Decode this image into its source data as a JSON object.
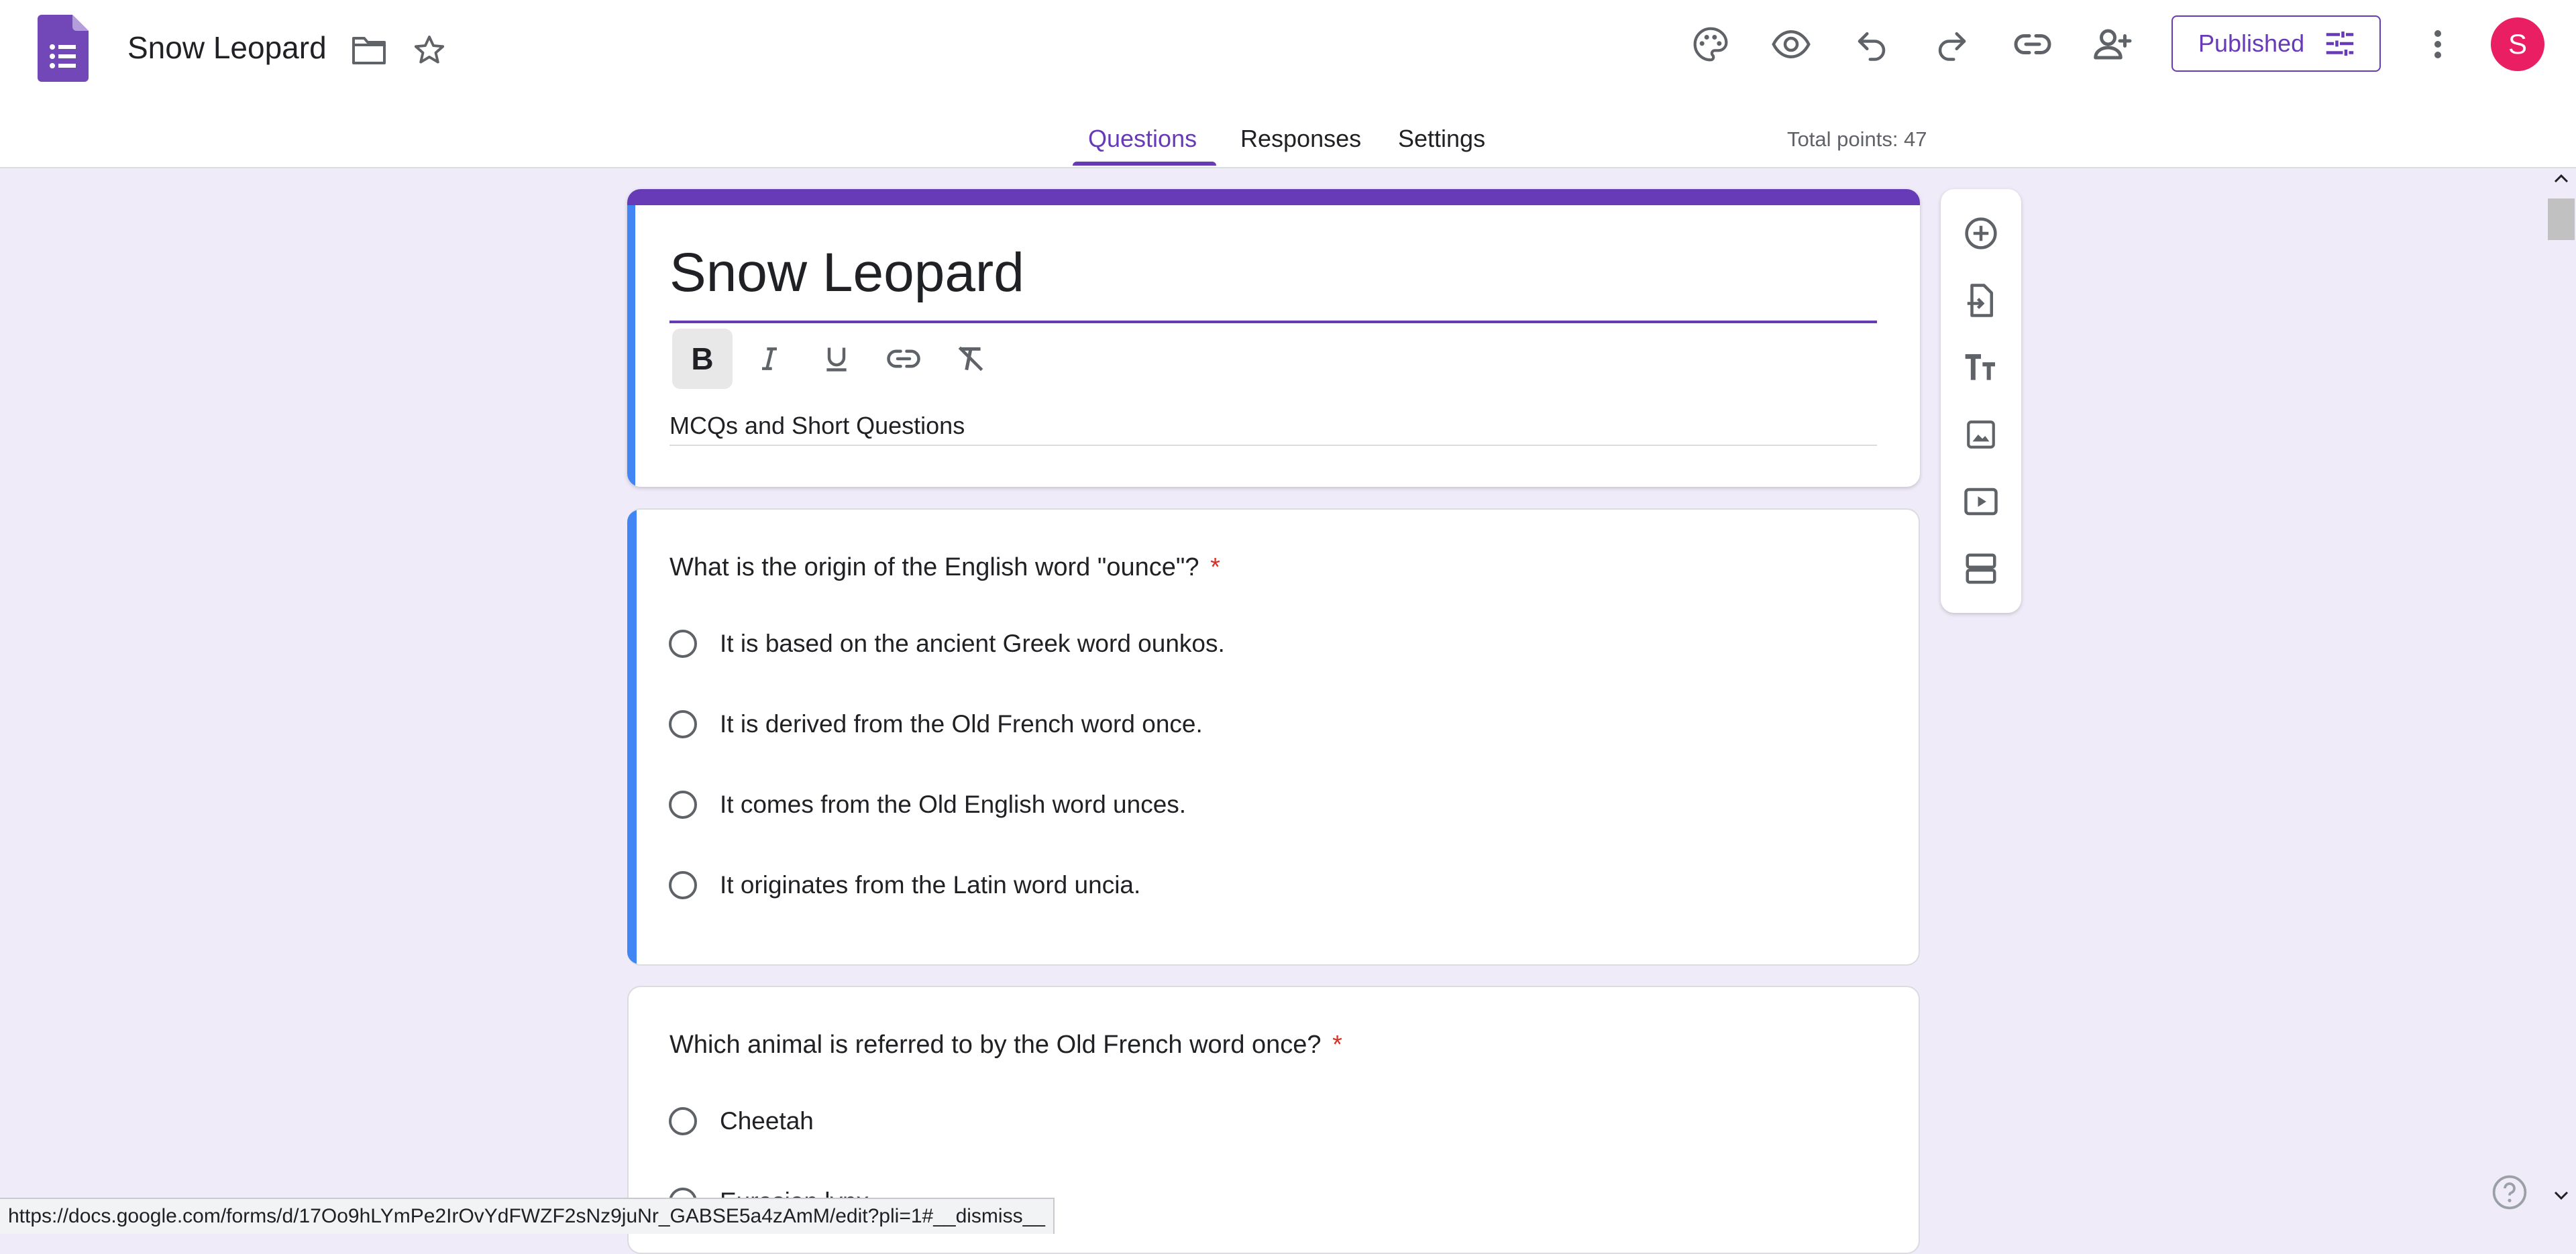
{
  "header": {
    "doc_title": "Snow Leopard",
    "publish_label": "Published",
    "avatar_letter": "S",
    "total_points": "Total points: 47"
  },
  "tabs": [
    {
      "label": "Questions",
      "active": true
    },
    {
      "label": "Responses",
      "active": false
    },
    {
      "label": "Settings",
      "active": false
    }
  ],
  "form": {
    "title": "Snow Leopard",
    "description": "MCQs and Short Questions"
  },
  "questions": [
    {
      "text": "What is the origin of the English word \"ounce\"?",
      "required_mark": "*",
      "options": [
        "It is based on the ancient Greek word ounkos.",
        "It is derived from the Old French word once.",
        "It comes from the Old English word unces.",
        "It originates from the Latin word uncia."
      ]
    },
    {
      "text": "Which animal is referred to by the Old French word once?",
      "required_mark": "*",
      "options": [
        "Cheetah",
        "Eurasian lynx"
      ]
    }
  ],
  "status_bar": {
    "url": "https://docs.google.com/forms/d/17Oo9hLYmPe2IrOvYdFWZF2sNz9juNr_GABSE5a4zAmM/edit?pli=1#__dismiss__"
  },
  "colors": {
    "accent": "#673ab7",
    "focus_bar": "#4285f4",
    "avatar_bg": "#e91e63",
    "required": "#d93025",
    "background": "#f0ebf8"
  },
  "icons": [
    "forms-logo-icon",
    "folder-icon",
    "star-icon",
    "palette-icon",
    "eye-icon",
    "undo-icon",
    "redo-icon",
    "link-icon",
    "add-person-icon",
    "tune-icon",
    "more-vert-icon",
    "bold-icon",
    "italic-icon",
    "underline-icon",
    "insert-link-icon",
    "clear-format-icon",
    "add-question-icon",
    "import-questions-icon",
    "add-title-icon",
    "add-image-icon",
    "add-video-icon",
    "add-section-icon",
    "help-icon"
  ]
}
